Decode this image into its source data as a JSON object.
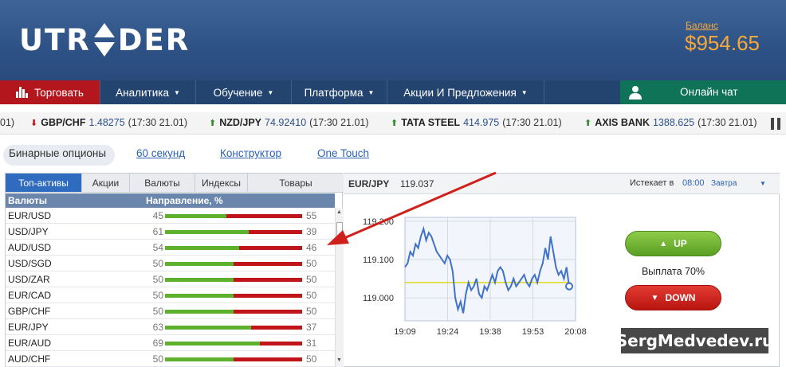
{
  "app": {
    "logo_text_left": "UTR",
    "logo_text_right": "DER",
    "balance_label": "Баланс",
    "balance_value": "$954.65"
  },
  "nav": {
    "trade": "Торговать",
    "analytics": "Аналитика",
    "education": "Обучение",
    "platform": "Платформа",
    "promos": "Акции И Предложения",
    "chat": "Онлайн чат"
  },
  "ticker": [
    {
      "dir": "",
      "symbol": "",
      "value": "",
      "time": "01)"
    },
    {
      "dir": "down",
      "symbol": "GBP/CHF",
      "value": "1.48275",
      "time": "(17:30 21.01)"
    },
    {
      "dir": "up",
      "symbol": "NZD/JPY",
      "value": "74.92410",
      "time": "(17:30 21.01)"
    },
    {
      "dir": "up",
      "symbol": "TATA STEEL",
      "value": "414.975",
      "time": "(17:30 21.01)"
    },
    {
      "dir": "up",
      "symbol": "AXIS BANK",
      "value": "1388.625",
      "time": "(17:30 21.01)"
    }
  ],
  "subtabs": {
    "binary": "Бинарные опционы",
    "sixty": "60 секунд",
    "builder": "Конструктор",
    "onetouch": "One Touch"
  },
  "asset_tabs": [
    "Топ-активы",
    "Акции",
    "Валюты",
    "Индексы",
    "Товары"
  ],
  "table": {
    "col_asset": "Валюты",
    "col_direction": "Направление, %",
    "rows": [
      {
        "pair": "EUR/USD",
        "left": 45,
        "right": 55
      },
      {
        "pair": "USD/JPY",
        "left": 61,
        "right": 39
      },
      {
        "pair": "AUD/USD",
        "left": 54,
        "right": 46
      },
      {
        "pair": "USD/SGD",
        "left": 50,
        "right": 50
      },
      {
        "pair": "USD/ZAR",
        "left": 50,
        "right": 50
      },
      {
        "pair": "EUR/CAD",
        "left": 50,
        "right": 50
      },
      {
        "pair": "GBP/CHF",
        "left": 50,
        "right": 50
      },
      {
        "pair": "EUR/JPY",
        "left": 63,
        "right": 37
      },
      {
        "pair": "EUR/AUD",
        "left": 69,
        "right": 31
      },
      {
        "pair": "AUD/CHF",
        "left": 50,
        "right": 50
      }
    ]
  },
  "chart_panel": {
    "symbol": "EUR/JPY",
    "price": "119.037",
    "expires_label": "Истекает в",
    "expires_time": "08:00",
    "expires_day": "Завтра",
    "up_label": "UP",
    "down_label": "DOWN",
    "payout": "Выплата 70%"
  },
  "chart_data": {
    "type": "line",
    "x_ticks": [
      "19:09",
      "19:24",
      "19:38",
      "19:53",
      "20:08"
    ],
    "y_ticks": [
      "119.200",
      "119.100",
      "119.000"
    ],
    "ylim": [
      118.94,
      119.21
    ],
    "strike": 119.04,
    "values": [
      119.08,
      119.09,
      119.12,
      119.11,
      119.14,
      119.13,
      119.16,
      119.18,
      119.15,
      119.17,
      119.16,
      119.14,
      119.12,
      119.11,
      119.1,
      119.09,
      119.11,
      119.1,
      119.07,
      119.0,
      118.97,
      118.99,
      118.96,
      119.01,
      119.04,
      119.02,
      119.03,
      119.05,
      119.01,
      119.0,
      119.03,
      119.02,
      119.04,
      119.06,
      119.04,
      119.07,
      119.08,
      119.07,
      119.04,
      119.02,
      119.03,
      119.05,
      119.03,
      119.04,
      119.05,
      119.06,
      119.04,
      119.03,
      119.05,
      119.06,
      119.04,
      119.07,
      119.09,
      119.13,
      119.1,
      119.16,
      119.12,
      119.08,
      119.06,
      119.07,
      119.05,
      119.08,
      119.03
    ]
  },
  "watermark": "SergMedvedev.ru",
  "colors": {
    "header": "#2e5285",
    "trade": "#b3161d",
    "chat": "#0f7357",
    "balance": "#f6a93a",
    "bar_green": "#5db12d",
    "bar_red": "#c0151b"
  }
}
